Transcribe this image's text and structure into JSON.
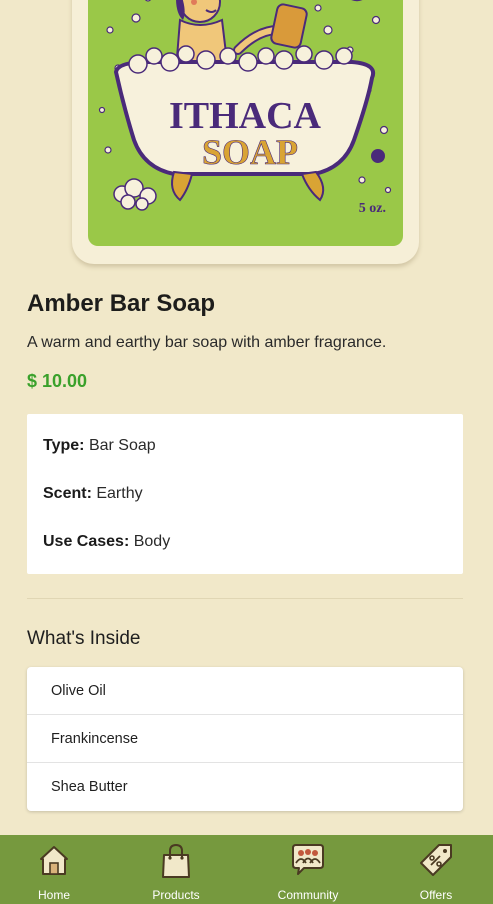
{
  "hero": {
    "brand_line1": "ITHACA",
    "brand_line2": "SOAP",
    "weight": "5 oz."
  },
  "product": {
    "name": "Amber Bar Soap",
    "description": "A warm and earthy bar soap with amber fragrance.",
    "price": "$ 10.00"
  },
  "details": [
    {
      "label": "Type:",
      "value": "Bar Soap"
    },
    {
      "label": "Scent:",
      "value": "Earthy"
    },
    {
      "label": "Use Cases:",
      "value": "Body"
    }
  ],
  "whats_inside": {
    "title": "What's Inside",
    "items": [
      "Olive Oil",
      "Frankincense",
      "Shea Butter"
    ]
  },
  "tabbar": {
    "tabs": [
      {
        "label": "Home",
        "icon": "home-icon"
      },
      {
        "label": "Products",
        "icon": "shopping-bag-icon"
      },
      {
        "label": "Community",
        "icon": "community-icon"
      },
      {
        "label": "Offers",
        "icon": "discount-tag-icon"
      }
    ]
  },
  "colors": {
    "background": "#f1e8c9",
    "price": "#3aa12b",
    "tabbar": "#76993e",
    "hero_green": "#9ac848",
    "brand_purple": "#4a2a7a",
    "brand_gold": "#d9a434"
  }
}
